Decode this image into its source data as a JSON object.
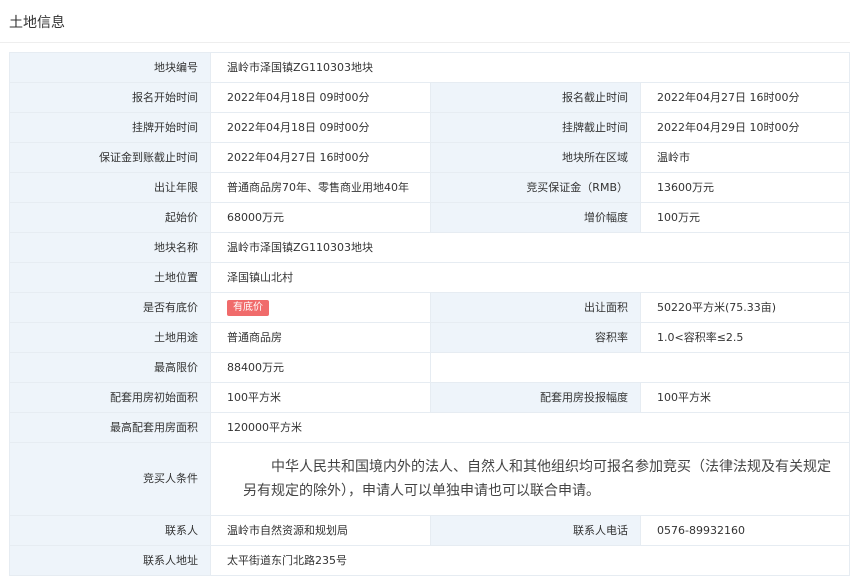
{
  "section": {
    "title": "土地信息"
  },
  "rows": {
    "parcel_no": {
      "label": "地块编号",
      "value": "温岭市泽国镇ZG110303地块"
    },
    "reg_start": {
      "label": "报名开始时间",
      "value": "2022年04月18日 09时00分"
    },
    "reg_end": {
      "label": "报名截止时间",
      "value": "2022年04月27日 16时00分"
    },
    "list_start": {
      "label": "挂牌开始时间",
      "value": "2022年04月18日 09时00分"
    },
    "list_end": {
      "label": "挂牌截止时间",
      "value": "2022年04月29日 10时00分"
    },
    "deposit_deadline": {
      "label": "保证金到账截止时间",
      "value": "2022年04月27日 16时00分"
    },
    "region": {
      "label": "地块所在区域",
      "value": "温岭市"
    },
    "term": {
      "label": "出让年限",
      "value": "普通商品房70年、零售商业用地40年"
    },
    "deposit": {
      "label": "竞买保证金（RMB）",
      "value": "13600万元"
    },
    "start_price": {
      "label": "起始价",
      "value": "68000万元"
    },
    "increment": {
      "label": "增价幅度",
      "value": "100万元"
    },
    "parcel_name": {
      "label": "地块名称",
      "value": "温岭市泽国镇ZG110303地块"
    },
    "location": {
      "label": "土地位置",
      "value": "泽国镇山北村"
    },
    "reserve": {
      "label": "是否有底价",
      "badge": "有底价"
    },
    "area": {
      "label": "出让面积",
      "value": "50220平方米(75.33亩)"
    },
    "use": {
      "label": "土地用途",
      "value": "普通商品房"
    },
    "far": {
      "label": "容积率",
      "value": "1.0<容积率≤2.5"
    },
    "max_price": {
      "label": "最高限价",
      "value": "88400万元"
    },
    "housing_init": {
      "label": "配套用房初始面积",
      "value": "100平方米"
    },
    "housing_bid": {
      "label": "配套用房投报幅度",
      "value": "100平方米"
    },
    "housing_max": {
      "label": "最高配套用房面积",
      "value": "120000平方米"
    },
    "bidder_cond": {
      "label": "竞买人条件",
      "value": "中华人民共和国境内外的法人、自然人和其他组织均可报名参加竞买（法律法规及有关规定另有规定的除外），申请人可以单独申请也可以联合申请。"
    },
    "contact": {
      "label": "联系人",
      "value": "温岭市自然资源和规划局"
    },
    "phone": {
      "label": "联系人电话",
      "value": "0576-89932160"
    },
    "address": {
      "label": "联系人地址",
      "value": "太平街道东门北路235号"
    }
  },
  "colors": {
    "label_bg": "#eef4fa",
    "border": "#e6ecf2",
    "badge": "#f06b6b"
  }
}
